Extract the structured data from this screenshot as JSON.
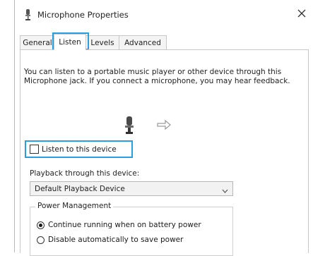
{
  "window": {
    "title": "Microphone Properties",
    "close_glyph": "✕"
  },
  "tabs": [
    {
      "label": "General"
    },
    {
      "label": "Listen",
      "active": true
    },
    {
      "label": "Levels"
    },
    {
      "label": "Advanced"
    }
  ],
  "listen": {
    "description": "You can listen to a portable music player or other device through this Microphone jack.  If you connect a microphone, you may hear feedback.",
    "checkbox_label": "Listen to this device",
    "checkbox_checked": false,
    "playback_label": "Playback through this device:",
    "playback_value": "Default Playback Device"
  },
  "power": {
    "group_title": "Power Management",
    "options": [
      {
        "label": "Continue running when on battery power",
        "checked": true
      },
      {
        "label": "Disable automatically to save power",
        "checked": false
      }
    ]
  },
  "highlight_color": "#2b9fd9",
  "icons": [
    "microphone-icon",
    "close-icon",
    "device-icon",
    "arrow-icon",
    "chevron-down-icon"
  ]
}
